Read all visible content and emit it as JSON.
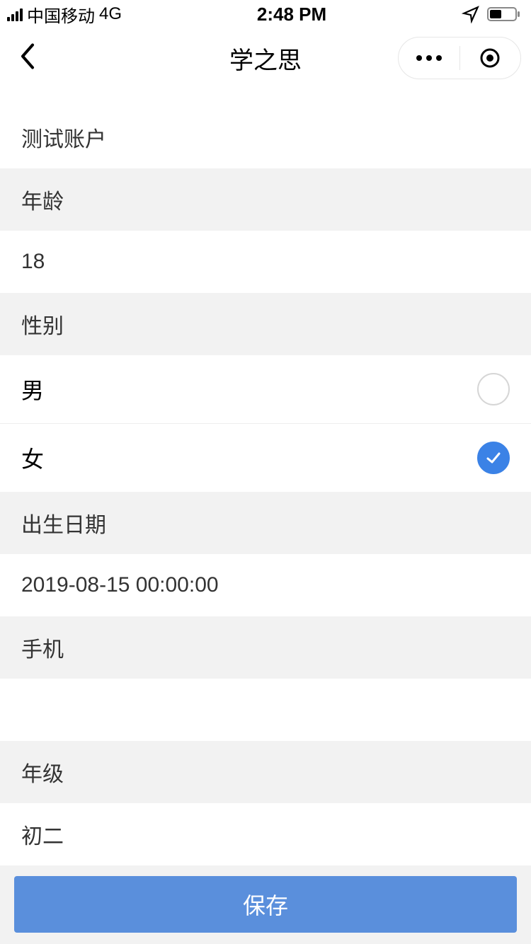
{
  "status": {
    "carrier": "中国移动",
    "network": "4G",
    "time": "2:48 PM"
  },
  "header": {
    "title": "学之思"
  },
  "form": {
    "account_value": "测试账户",
    "age_label": "年龄",
    "age_value": "18",
    "gender_label": "性别",
    "gender_options": {
      "male": "男",
      "female": "女"
    },
    "gender_selected": "female",
    "birth_label": "出生日期",
    "birth_value": "2019-08-15 00:00:00",
    "phone_label": "手机",
    "phone_value": "",
    "grade_label": "年级",
    "grade_value": "初二"
  },
  "actions": {
    "save": "保存"
  }
}
